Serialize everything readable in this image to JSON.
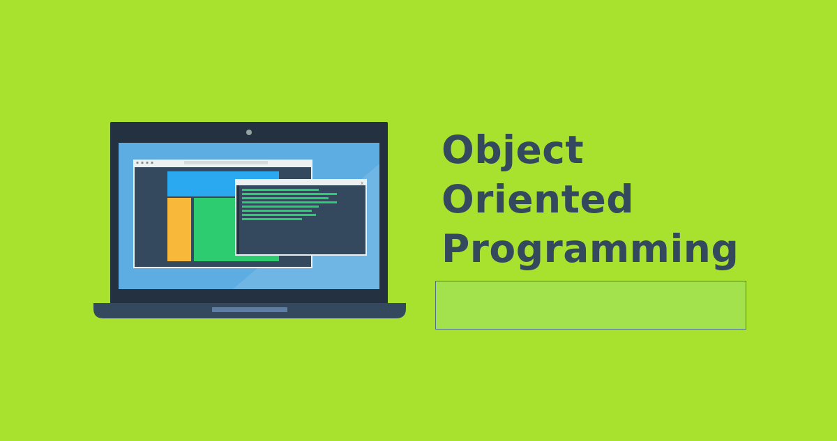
{
  "title": {
    "lines": [
      "Object",
      "Oriented",
      "Programming"
    ]
  },
  "colors": {
    "background": "#a8e22f",
    "title_text": "#34495e",
    "laptop_body": "#233141",
    "screen": "#5dade2",
    "code_line": "#2ecc71",
    "input_box_border": "#4a6f8a"
  },
  "illustration": {
    "icon": "laptop-with-windows-icon"
  },
  "input_box": {
    "value": ""
  }
}
